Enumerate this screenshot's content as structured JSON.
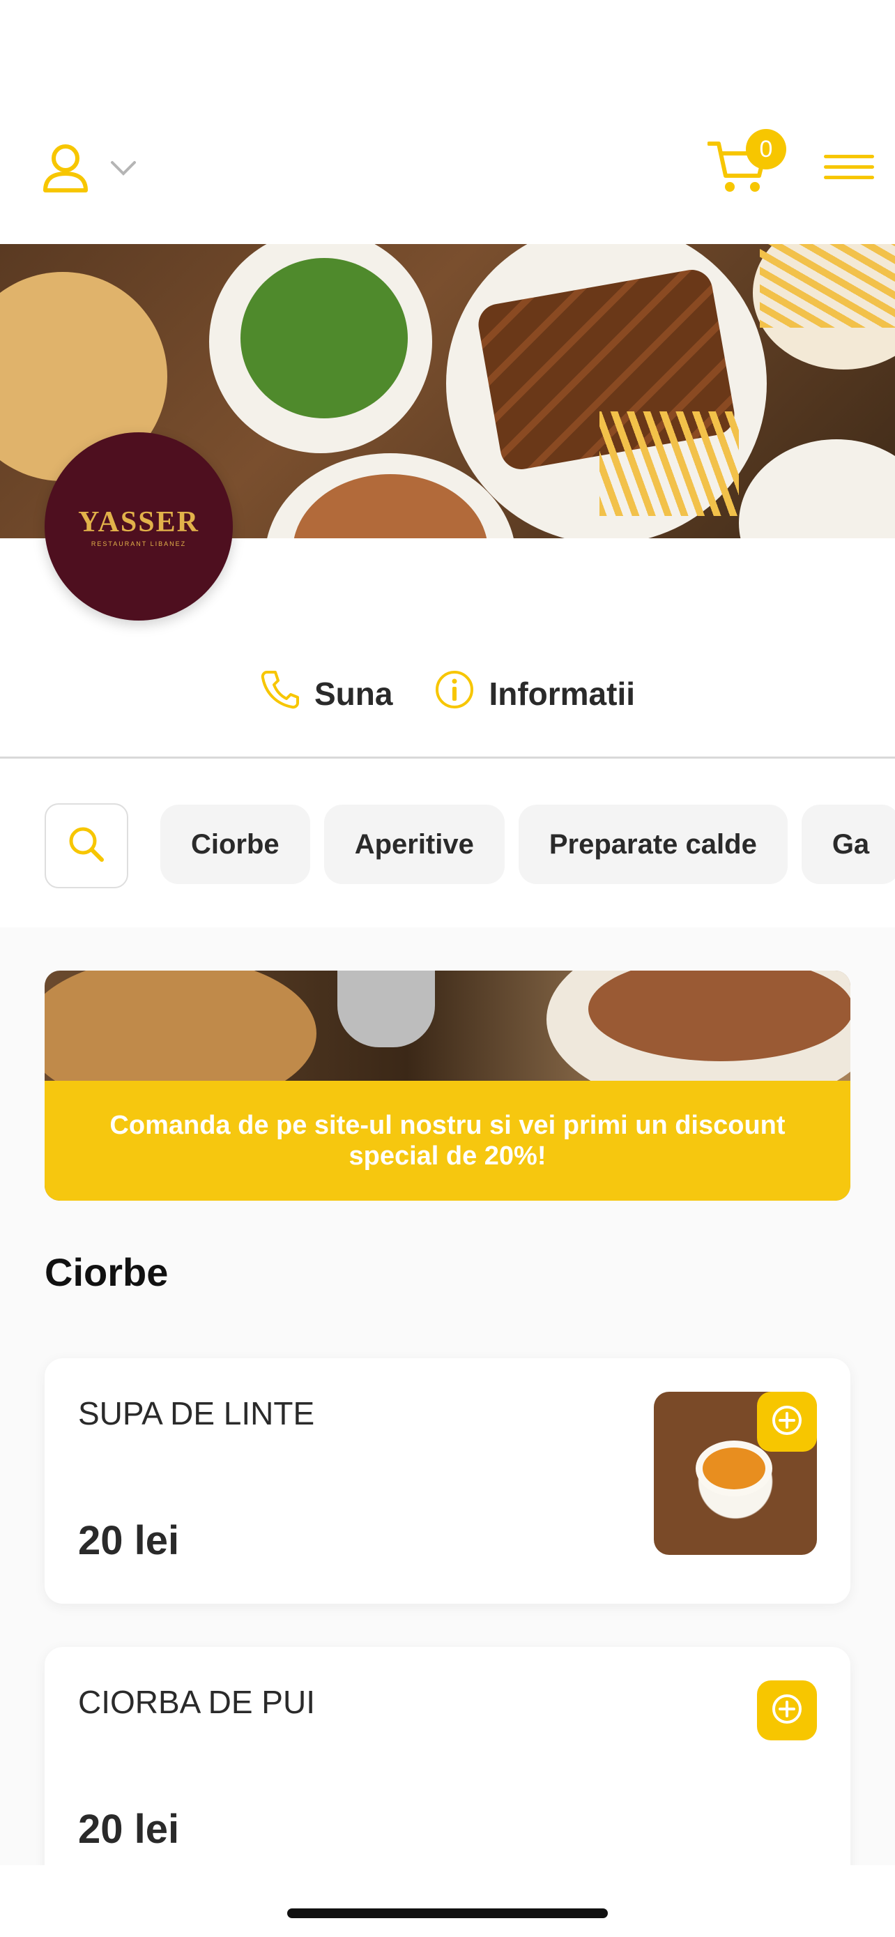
{
  "header": {
    "cart_count": "0"
  },
  "restaurant": {
    "logo_text": "YASSER",
    "logo_subtext": "RESTAURANT LIBANEZ"
  },
  "actions": {
    "call_label": "Suna",
    "info_label": "Informatii"
  },
  "categories": [
    {
      "label": "Ciorbe"
    },
    {
      "label": "Aperitive"
    },
    {
      "label": "Preparate calde"
    },
    {
      "label": "Ga"
    }
  ],
  "promo": {
    "text": "Comanda de pe site-ul nostru si vei primi un discount special de 20%!"
  },
  "section": {
    "title": "Ciorbe"
  },
  "products": [
    {
      "name": "SUPA DE LINTE",
      "price": "20 lei"
    },
    {
      "name": "CIORBA DE PUI",
      "price": "20 lei"
    }
  ],
  "colors": {
    "accent": "#F7C600",
    "logo_bg": "#4E0F1F",
    "logo_text": "#E2B24A"
  }
}
